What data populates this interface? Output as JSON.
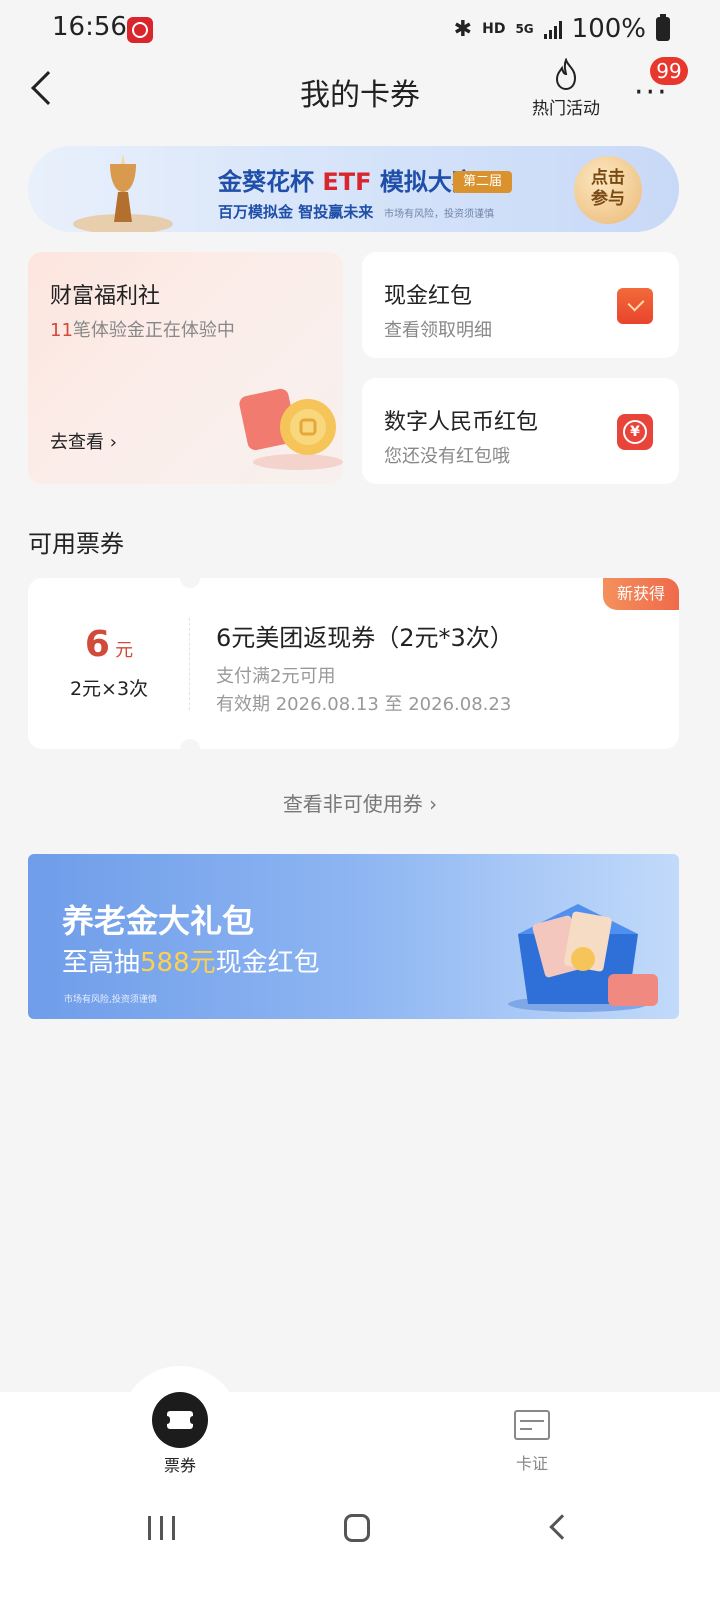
{
  "status_bar": {
    "time": "16:56",
    "network_hd": "HD",
    "network_5g": "5G",
    "battery": "100%"
  },
  "header": {
    "title": "我的卡券",
    "hot_activity_label": "热门活动",
    "more_badge": "99"
  },
  "etf_banner": {
    "title_prefix": "金葵花杯 ",
    "title_red": "ETF",
    "title_suffix": " 模拟大赛",
    "tag": "第二届",
    "subtitle": "百万模拟金 智投赢未来",
    "risk_note": "市场有风险，投资须谨慎",
    "join_line1": "点击",
    "join_line2": "参与"
  },
  "welfare_card": {
    "title": "财富福利社",
    "count": "11",
    "desc": "笔体验金正在体验中",
    "link": "去查看 ›"
  },
  "cash_card": {
    "title": "现金红包",
    "desc": "查看领取明细",
    "icon": "red-packet-icon"
  },
  "rmb_card": {
    "title": "数字人民币红包",
    "desc": "您还没有红包哦",
    "icon": "ecny-icon"
  },
  "available_section": {
    "title": "可用票券"
  },
  "coupon": {
    "amount": "6",
    "unit": "元",
    "times": "2元×3次",
    "name": "6元美团返现券（2元*3次）",
    "condition": "支付满2元可用",
    "validity": "有效期 2026.08.13 至 2026.08.23",
    "tag": "新获得"
  },
  "view_unusable": "查看非可使用券 ›",
  "pension_banner": {
    "title": "养老金大礼包",
    "sub_prefix": "至高抽",
    "sub_amount": "588元",
    "sub_suffix": "现金红包",
    "risk_note": "市场有风险,投资须谨慎"
  },
  "tab_bar": {
    "tabs": [
      {
        "label": "票券",
        "active": true,
        "icon": "ticket-icon"
      },
      {
        "label": "卡证",
        "active": false,
        "icon": "card-icon"
      }
    ]
  },
  "colors": {
    "accent_red": "#d24a3a",
    "badge_red": "#e8382d",
    "gold": "#ffd04c"
  }
}
